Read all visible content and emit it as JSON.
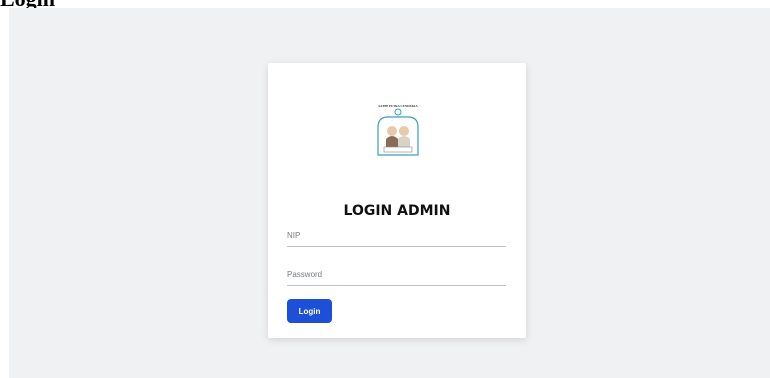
{
  "page": {
    "heading": "Login"
  },
  "card": {
    "title": "LOGIN ADMIN",
    "logo_caption": "SATPP PUTRA CENDEKIA",
    "nip": {
      "value": "",
      "placeholder": "NIP"
    },
    "password": {
      "value": "",
      "placeholder": "Password"
    },
    "login_label": "Login"
  },
  "colors": {
    "background": "#f0f1f3",
    "card": "#ffffff",
    "accent": "#1e4fd8"
  }
}
